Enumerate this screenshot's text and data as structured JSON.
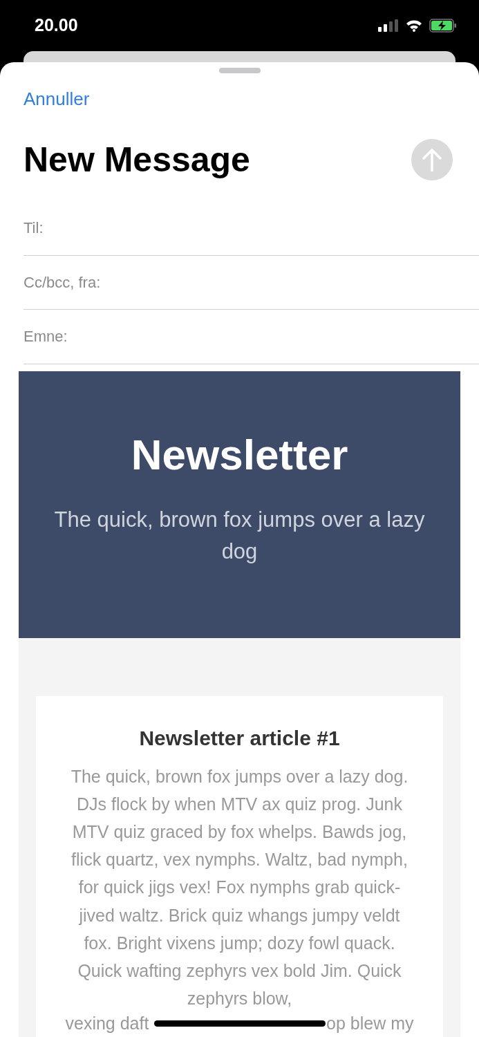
{
  "status_bar": {
    "time": "20.00"
  },
  "compose": {
    "cancel": "Annuller",
    "title": "New Message",
    "fields": [
      {
        "label": "Til:"
      },
      {
        "label": "Cc/bcc, fra:"
      },
      {
        "label": "Emne:"
      }
    ]
  },
  "newsletter": {
    "title": "Newsletter",
    "subtitle": "The quick, brown fox jumps over a lazy dog",
    "article": {
      "title": "Newsletter article #1",
      "body": "The quick, brown fox jumps over a lazy dog. DJs flock by when MTV ax quiz prog. Junk MTV quiz graced by fox whelps. Bawds jog, flick quartz, vex nymphs. Waltz, bad nymph, for quick jigs vex! Fox nymphs grab quick-jived waltz. Brick quiz whangs jumpy veldt fox. Bright vixens jump; dozy fowl quack. Quick wafting zephyrs vex bold Jim. Quick zephyrs blow,",
      "body_tail": [
        "vexing daft",
        "op blew my"
      ]
    }
  }
}
